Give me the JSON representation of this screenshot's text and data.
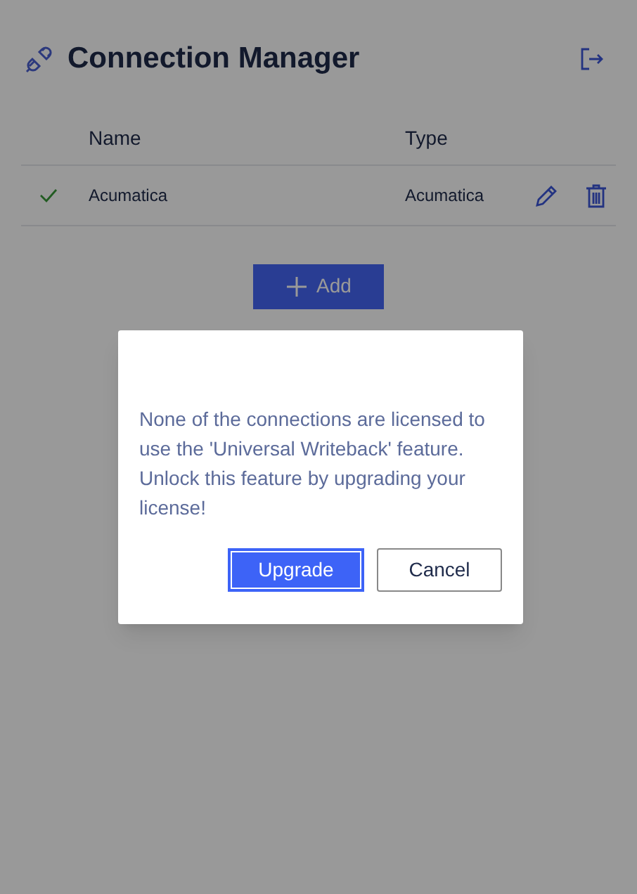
{
  "header": {
    "title": "Connection Manager"
  },
  "table": {
    "columns": [
      "Name",
      "Type"
    ],
    "rows": [
      {
        "active": true,
        "name": "Acumatica",
        "type": "Acumatica"
      }
    ]
  },
  "add_button": {
    "label": "Add"
  },
  "dialog": {
    "message": "None of the connections are licensed to use the 'Universal Writeback' feature. Unlock this feature by upgrading your license!",
    "buttons": [
      {
        "label": "Upgrade",
        "kind": "primary"
      },
      {
        "label": "Cancel",
        "kind": "secondary"
      }
    ]
  }
}
